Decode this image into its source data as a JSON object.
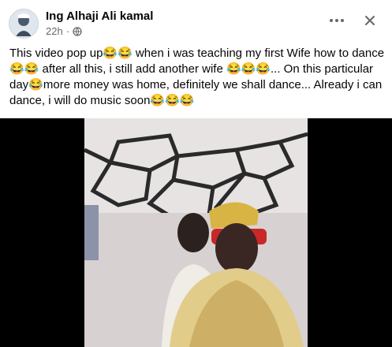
{
  "post": {
    "author": "Ing Alhaji Ali kamal",
    "time": "22h",
    "separator": "·",
    "privacy_icon": "globe-icon",
    "more_icon": "more-options-icon",
    "close_icon": "close-icon",
    "text": "This video pop up😂😂 when i was teaching my first Wife how to dance 😂😂 after all this, i still add another wife 😂😂😂... On this particular day😂more money was home, definitely we shall dance... Already i can dance, i will do music soon😂😂😂"
  },
  "colors": {
    "text_primary": "#050505",
    "text_secondary": "#65676b",
    "video_background": "#000000"
  }
}
